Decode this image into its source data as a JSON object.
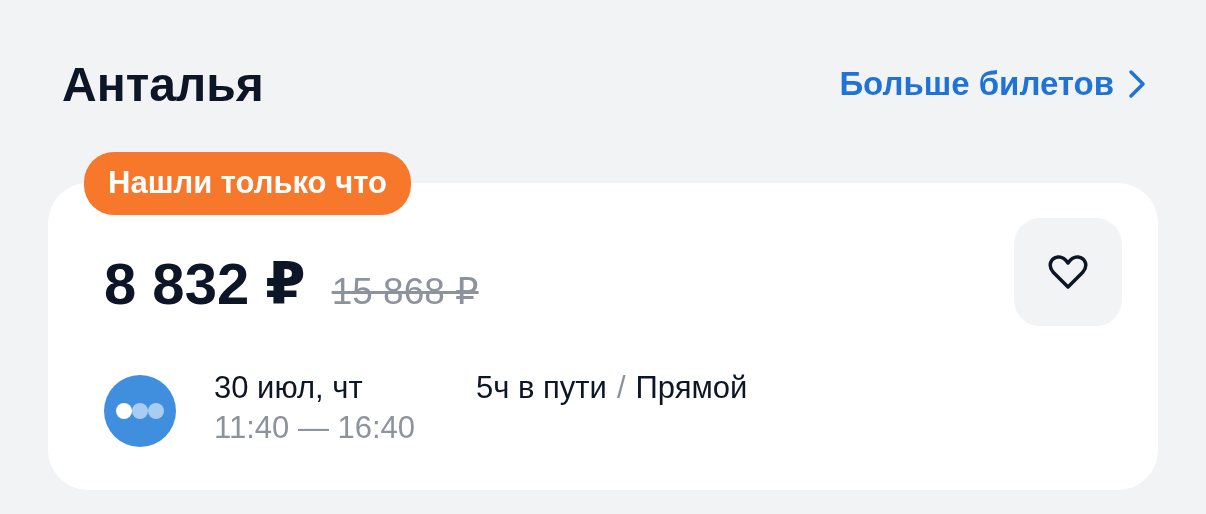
{
  "section": {
    "title": "Анталья",
    "more_link": "Больше билетов"
  },
  "ticket": {
    "badge": "Нашли только что",
    "price": "8 832 ₽",
    "old_price": "15 868 ₽",
    "favorited": false,
    "date": "30 июл, чт",
    "times": "11:40 — 16:40",
    "duration": "5ч в пути",
    "separator": "/",
    "flight_type": "Прямой"
  }
}
